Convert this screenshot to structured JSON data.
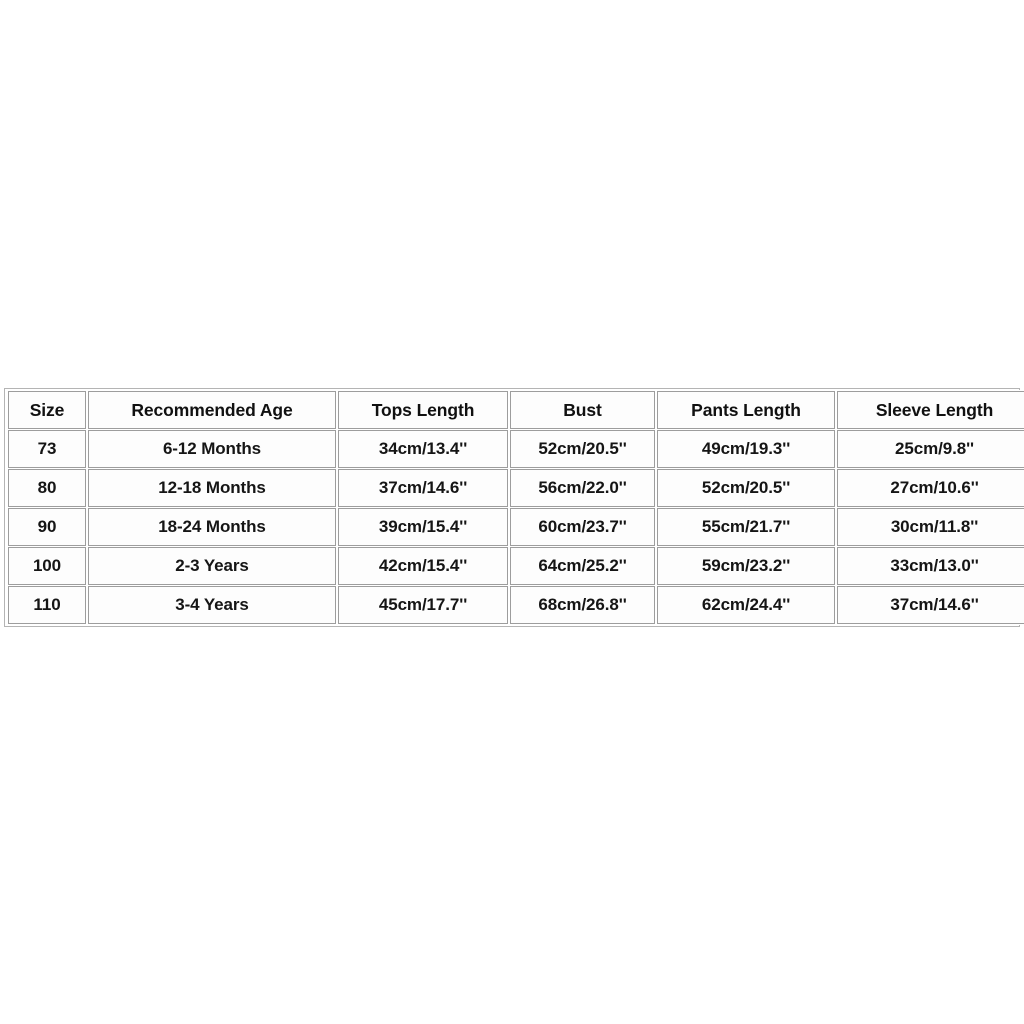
{
  "page": {
    "background_color": "#ffffff",
    "border_color": "#9d9d9d",
    "text_color": "#151515"
  },
  "size_table": {
    "columns": [
      "Size",
      "Recommended Age",
      "Tops Length",
      "Bust",
      "Pants Length",
      "Sleeve Length"
    ],
    "rows": [
      {
        "size": "73",
        "age": "6-12 Months",
        "tops_length": "34cm/13.4''",
        "bust": "52cm/20.5''",
        "pants_length": "49cm/19.3''",
        "sleeve_length": "25cm/9.8''"
      },
      {
        "size": "80",
        "age": "12-18 Months",
        "tops_length": "37cm/14.6''",
        "bust": "56cm/22.0''",
        "pants_length": "52cm/20.5''",
        "sleeve_length": "27cm/10.6''"
      },
      {
        "size": "90",
        "age": "18-24 Months",
        "tops_length": "39cm/15.4''",
        "bust": "60cm/23.7''",
        "pants_length": "55cm/21.7''",
        "sleeve_length": "30cm/11.8''"
      },
      {
        "size": "100",
        "age": "2-3 Years",
        "tops_length": "42cm/15.4''",
        "bust": "64cm/25.2''",
        "pants_length": "59cm/23.2''",
        "sleeve_length": "33cm/13.0''"
      },
      {
        "size": "110",
        "age": "3-4 Years",
        "tops_length": "45cm/17.7''",
        "bust": "68cm/26.8''",
        "pants_length": "62cm/24.4''",
        "sleeve_length": "37cm/14.6''"
      }
    ]
  }
}
